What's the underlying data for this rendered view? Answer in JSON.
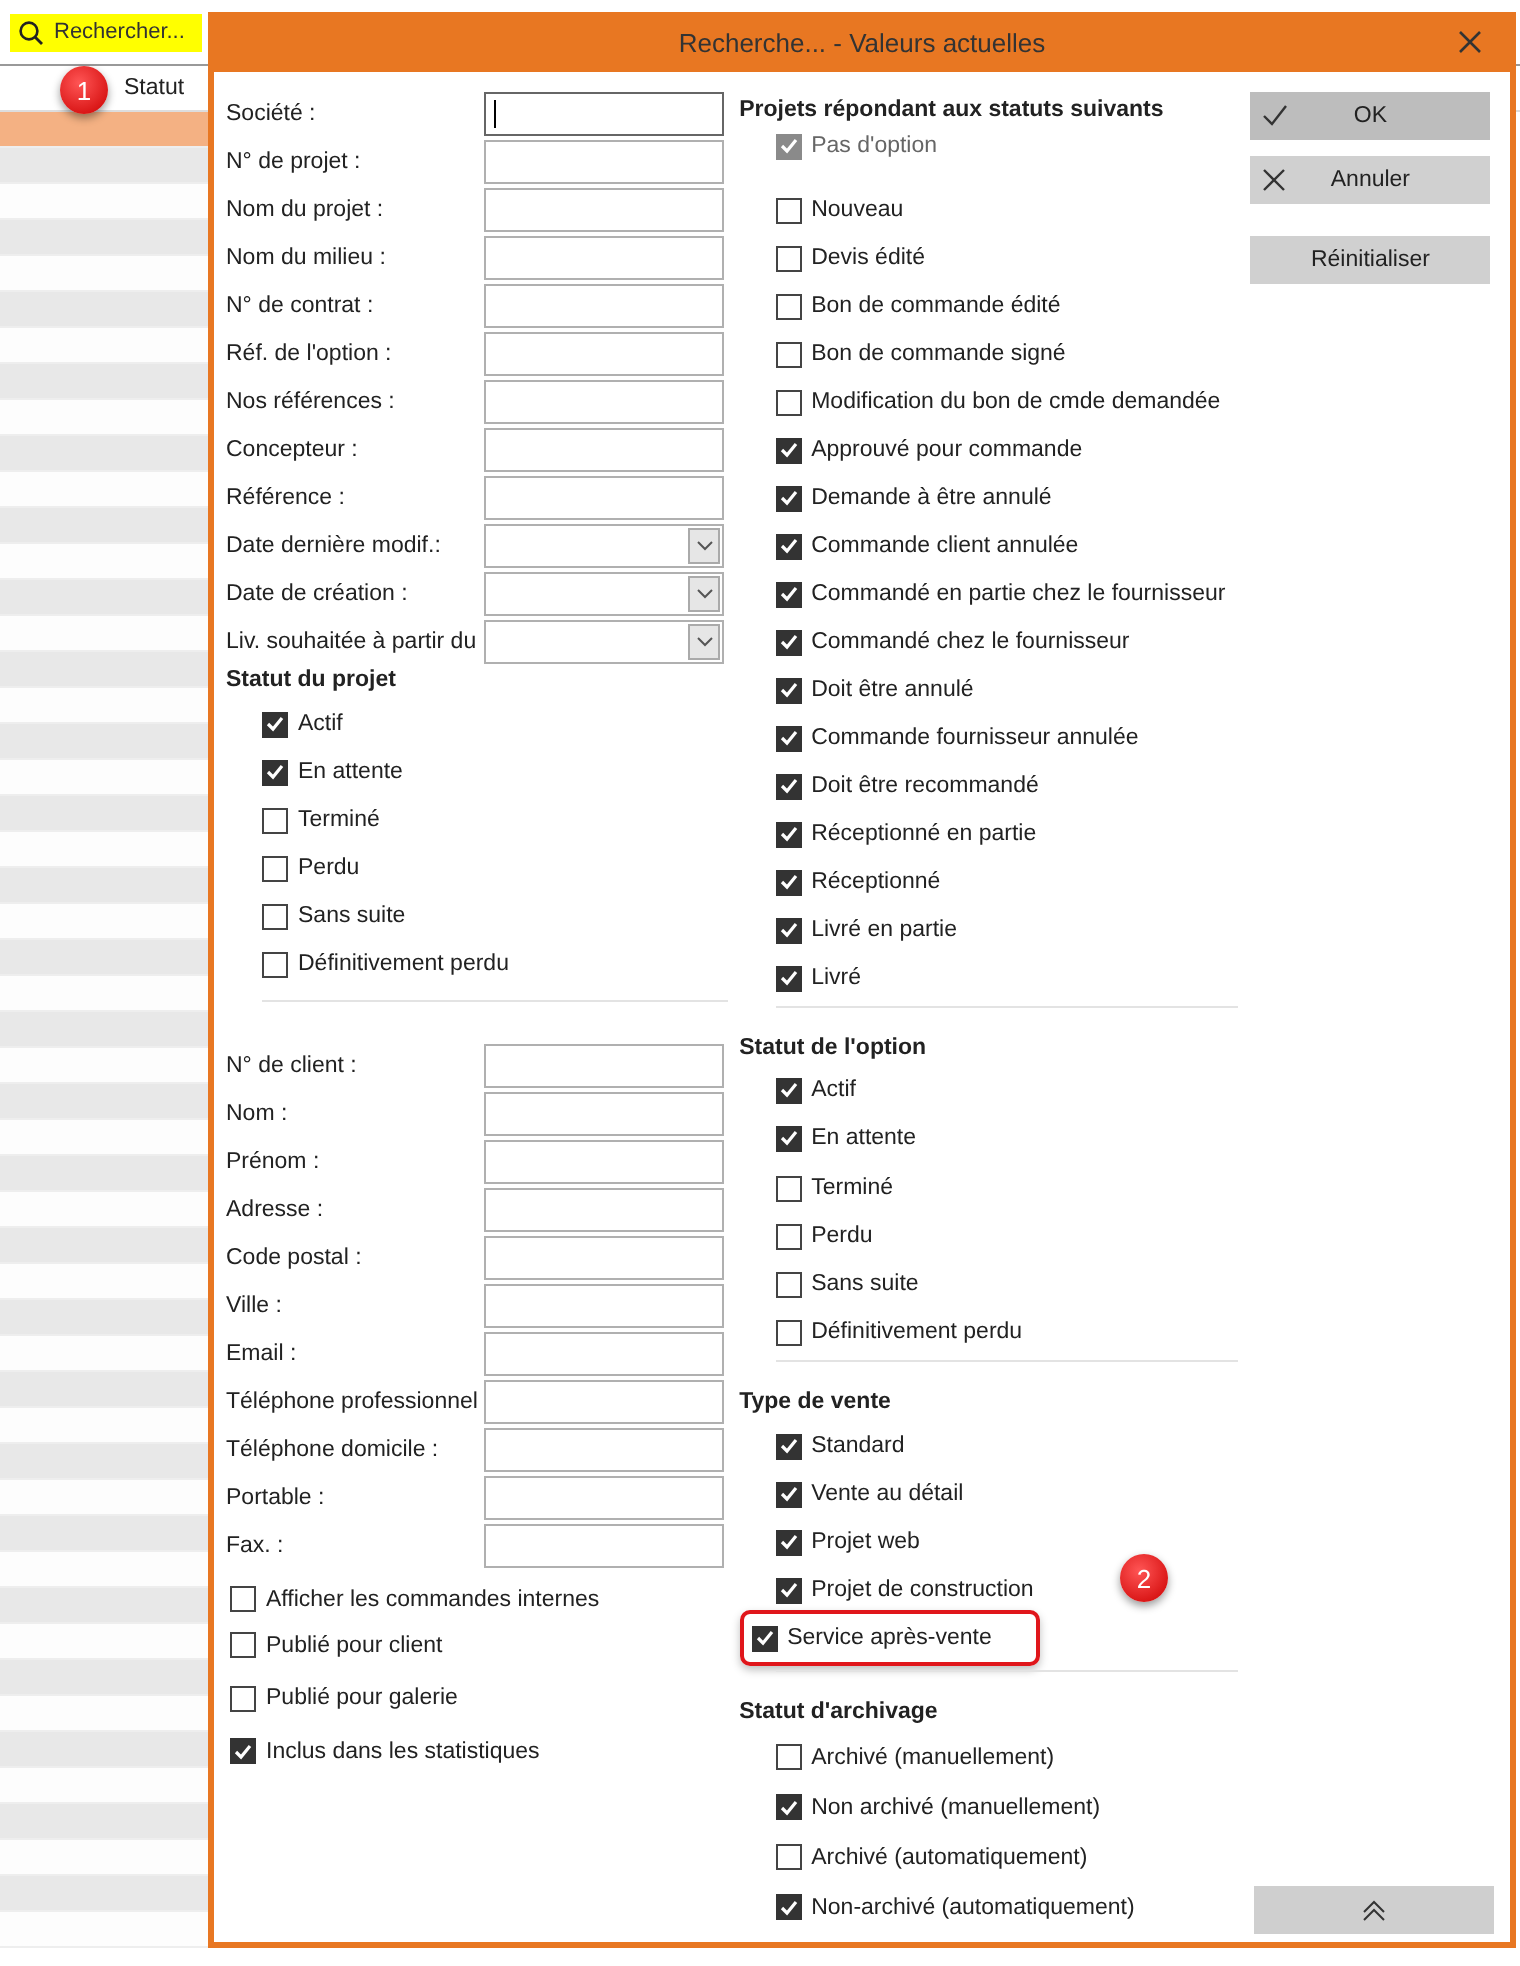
{
  "toolbar": {
    "search_button": "Rechercher..."
  },
  "table": {
    "columns": [
      "Statut"
    ],
    "annotation": "1",
    "rows": [
      {
        "selected": true
      },
      {
        "selected": false
      },
      {
        "selected": false
      },
      {
        "selected": false
      },
      {
        "selected": false
      },
      {
        "selected": false
      },
      {
        "selected": false
      },
      {
        "selected": false
      },
      {
        "selected": false
      },
      {
        "selected": false
      },
      {
        "selected": false
      },
      {
        "selected": false
      },
      {
        "selected": false
      },
      {
        "selected": false
      },
      {
        "selected": false
      },
      {
        "selected": false
      },
      {
        "selected": false
      },
      {
        "selected": false
      },
      {
        "selected": false
      },
      {
        "selected": false
      },
      {
        "selected": false
      },
      {
        "selected": false
      },
      {
        "selected": false
      },
      {
        "selected": false
      },
      {
        "selected": false
      },
      {
        "selected": false
      },
      {
        "selected": false
      },
      {
        "selected": false
      },
      {
        "selected": false
      },
      {
        "selected": false
      },
      {
        "selected": false
      },
      {
        "selected": false
      },
      {
        "selected": false
      },
      {
        "selected": false
      },
      {
        "selected": false
      },
      {
        "selected": false
      },
      {
        "selected": false
      },
      {
        "selected": false
      },
      {
        "selected": false
      },
      {
        "selected": false
      },
      {
        "selected": false
      },
      {
        "selected": false
      },
      {
        "selected": false
      },
      {
        "selected": false
      },
      {
        "selected": false
      },
      {
        "selected": false
      },
      {
        "selected": false
      },
      {
        "selected": false
      },
      {
        "selected": false
      },
      {
        "selected": false
      },
      {
        "selected": false
      }
    ]
  },
  "dialog": {
    "title": "Recherche... - Valeurs actuelles",
    "fields": [
      {
        "label": "Société :",
        "kind": "text",
        "focused": true
      },
      {
        "label": "N° de projet :",
        "kind": "text",
        "focused": false
      },
      {
        "label": "Nom du projet :",
        "kind": "text",
        "focused": false
      },
      {
        "label": "Nom du milieu :",
        "kind": "text",
        "focused": false
      },
      {
        "label": "N° de contrat :",
        "kind": "text",
        "focused": false
      },
      {
        "label": "Réf. de l'option :",
        "kind": "text",
        "focused": false
      },
      {
        "label": "Nos références :",
        "kind": "text",
        "focused": false
      },
      {
        "label": "Concepteur :",
        "kind": "text",
        "focused": false
      },
      {
        "label": "Référence :",
        "kind": "text",
        "focused": false
      },
      {
        "label": "Date dernière modif.:",
        "kind": "dropdown",
        "focused": false
      },
      {
        "label": "Date de création :",
        "kind": "dropdown",
        "focused": false
      },
      {
        "label": "Liv. souhaitée à partir du",
        "kind": "dropdown",
        "focused": false
      }
    ],
    "project_status": {
      "title": "Statut du projet",
      "items": [
        {
          "label": "Actif",
          "checked": true
        },
        {
          "label": "En attente",
          "checked": true
        },
        {
          "label": "Terminé",
          "checked": false
        },
        {
          "label": "Perdu",
          "checked": false
        },
        {
          "label": "Sans suite",
          "checked": false
        },
        {
          "label": "Définitivement perdu",
          "checked": false
        }
      ]
    },
    "client_fields": [
      {
        "label": "N° de client :",
        "kind": "text",
        "focused": false
      },
      {
        "label": "Nom :",
        "kind": "text",
        "focused": false
      },
      {
        "label": "Prénom :",
        "kind": "text",
        "focused": false
      },
      {
        "label": "Adresse :",
        "kind": "text",
        "focused": false
      },
      {
        "label": "Code postal :",
        "kind": "text",
        "focused": false
      },
      {
        "label": "Ville :",
        "kind": "text",
        "focused": false
      },
      {
        "label": "Email :",
        "kind": "text",
        "focused": false
      },
      {
        "label": "Téléphone professionnel",
        "kind": "text",
        "focused": false
      },
      {
        "label": "Téléphone domicile :",
        "kind": "text",
        "focused": false
      },
      {
        "label": "Portable :",
        "kind": "text",
        "focused": false
      },
      {
        "label": "Fax. :",
        "kind": "text",
        "focused": false
      }
    ],
    "options": [
      {
        "label": "Afficher les commandes internes",
        "checked": false
      },
      {
        "label": "Publié pour client",
        "checked": false
      },
      {
        "label": "Publié pour galerie",
        "checked": false
      },
      {
        "label": "Inclus dans les statistiques",
        "checked": true
      }
    ],
    "statuses": {
      "title": "Projets répondant aux statuts suivants",
      "items": [
        {
          "label": "Pas d'option",
          "checked": true,
          "disabled": true
        },
        {
          "label": "Nouveau",
          "checked": false,
          "disabled": false
        },
        {
          "label": "Devis édité",
          "checked": false,
          "disabled": false
        },
        {
          "label": "Bon de commande édité",
          "checked": false,
          "disabled": false
        },
        {
          "label": "Bon de commande signé",
          "checked": false,
          "disabled": false
        },
        {
          "label": "Modification du bon de cmde demandée",
          "checked": false,
          "disabled": false
        },
        {
          "label": "Approuvé pour commande",
          "checked": true,
          "disabled": false
        },
        {
          "label": "Demande à être annulé",
          "checked": true,
          "disabled": false
        },
        {
          "label": "Commande client annulée",
          "checked": true,
          "disabled": false
        },
        {
          "label": "Commandé en partie chez le fournisseur",
          "checked": true,
          "disabled": false
        },
        {
          "label": "Commandé chez le fournisseur",
          "checked": true,
          "disabled": false
        },
        {
          "label": "Doit être annulé",
          "checked": true,
          "disabled": false
        },
        {
          "label": "Commande fournisseur annulée",
          "checked": true,
          "disabled": false
        },
        {
          "label": "Doit être recommandé",
          "checked": true,
          "disabled": false
        },
        {
          "label": "Réceptionné en partie",
          "checked": true,
          "disabled": false
        },
        {
          "label": "Réceptionné",
          "checked": true,
          "disabled": false
        },
        {
          "label": "Livré en partie",
          "checked": true,
          "disabled": false
        },
        {
          "label": "Livré",
          "checked": true,
          "disabled": false
        }
      ]
    },
    "option_status": {
      "title": "Statut de l'option",
      "items": [
        {
          "label": "Actif",
          "checked": true
        },
        {
          "label": "En attente",
          "checked": true
        },
        {
          "label": "Terminé",
          "checked": false
        },
        {
          "label": "Perdu",
          "checked": false
        },
        {
          "label": "Sans suite",
          "checked": false
        },
        {
          "label": "Définitivement perdu",
          "checked": false
        }
      ]
    },
    "sale_type": {
      "title": "Type de vente",
      "annotation": "2",
      "items": [
        {
          "label": "Standard",
          "checked": true,
          "highlighted": false
        },
        {
          "label": "Vente au détail",
          "checked": true,
          "highlighted": false
        },
        {
          "label": "Projet web",
          "checked": true,
          "highlighted": false
        },
        {
          "label": "Projet de construction",
          "checked": true,
          "highlighted": false
        },
        {
          "label": "Service après-vente",
          "checked": true,
          "highlighted": true
        }
      ]
    },
    "archive_status": {
      "title": "Statut d'archivage",
      "items": [
        {
          "label": "Archivé (manuellement)",
          "checked": false
        },
        {
          "label": "Non archivé (manuellement)",
          "checked": true
        },
        {
          "label": "Archivé (automatiquement)",
          "checked": false
        },
        {
          "label": "Non-archivé (automatiquement)",
          "checked": true
        }
      ]
    },
    "buttons": [
      {
        "label": "OK",
        "kind": "ok"
      },
      {
        "label": "Annuler",
        "kind": "cancel"
      },
      {
        "label": "Réinitialiser",
        "kind": "plain"
      }
    ]
  }
}
